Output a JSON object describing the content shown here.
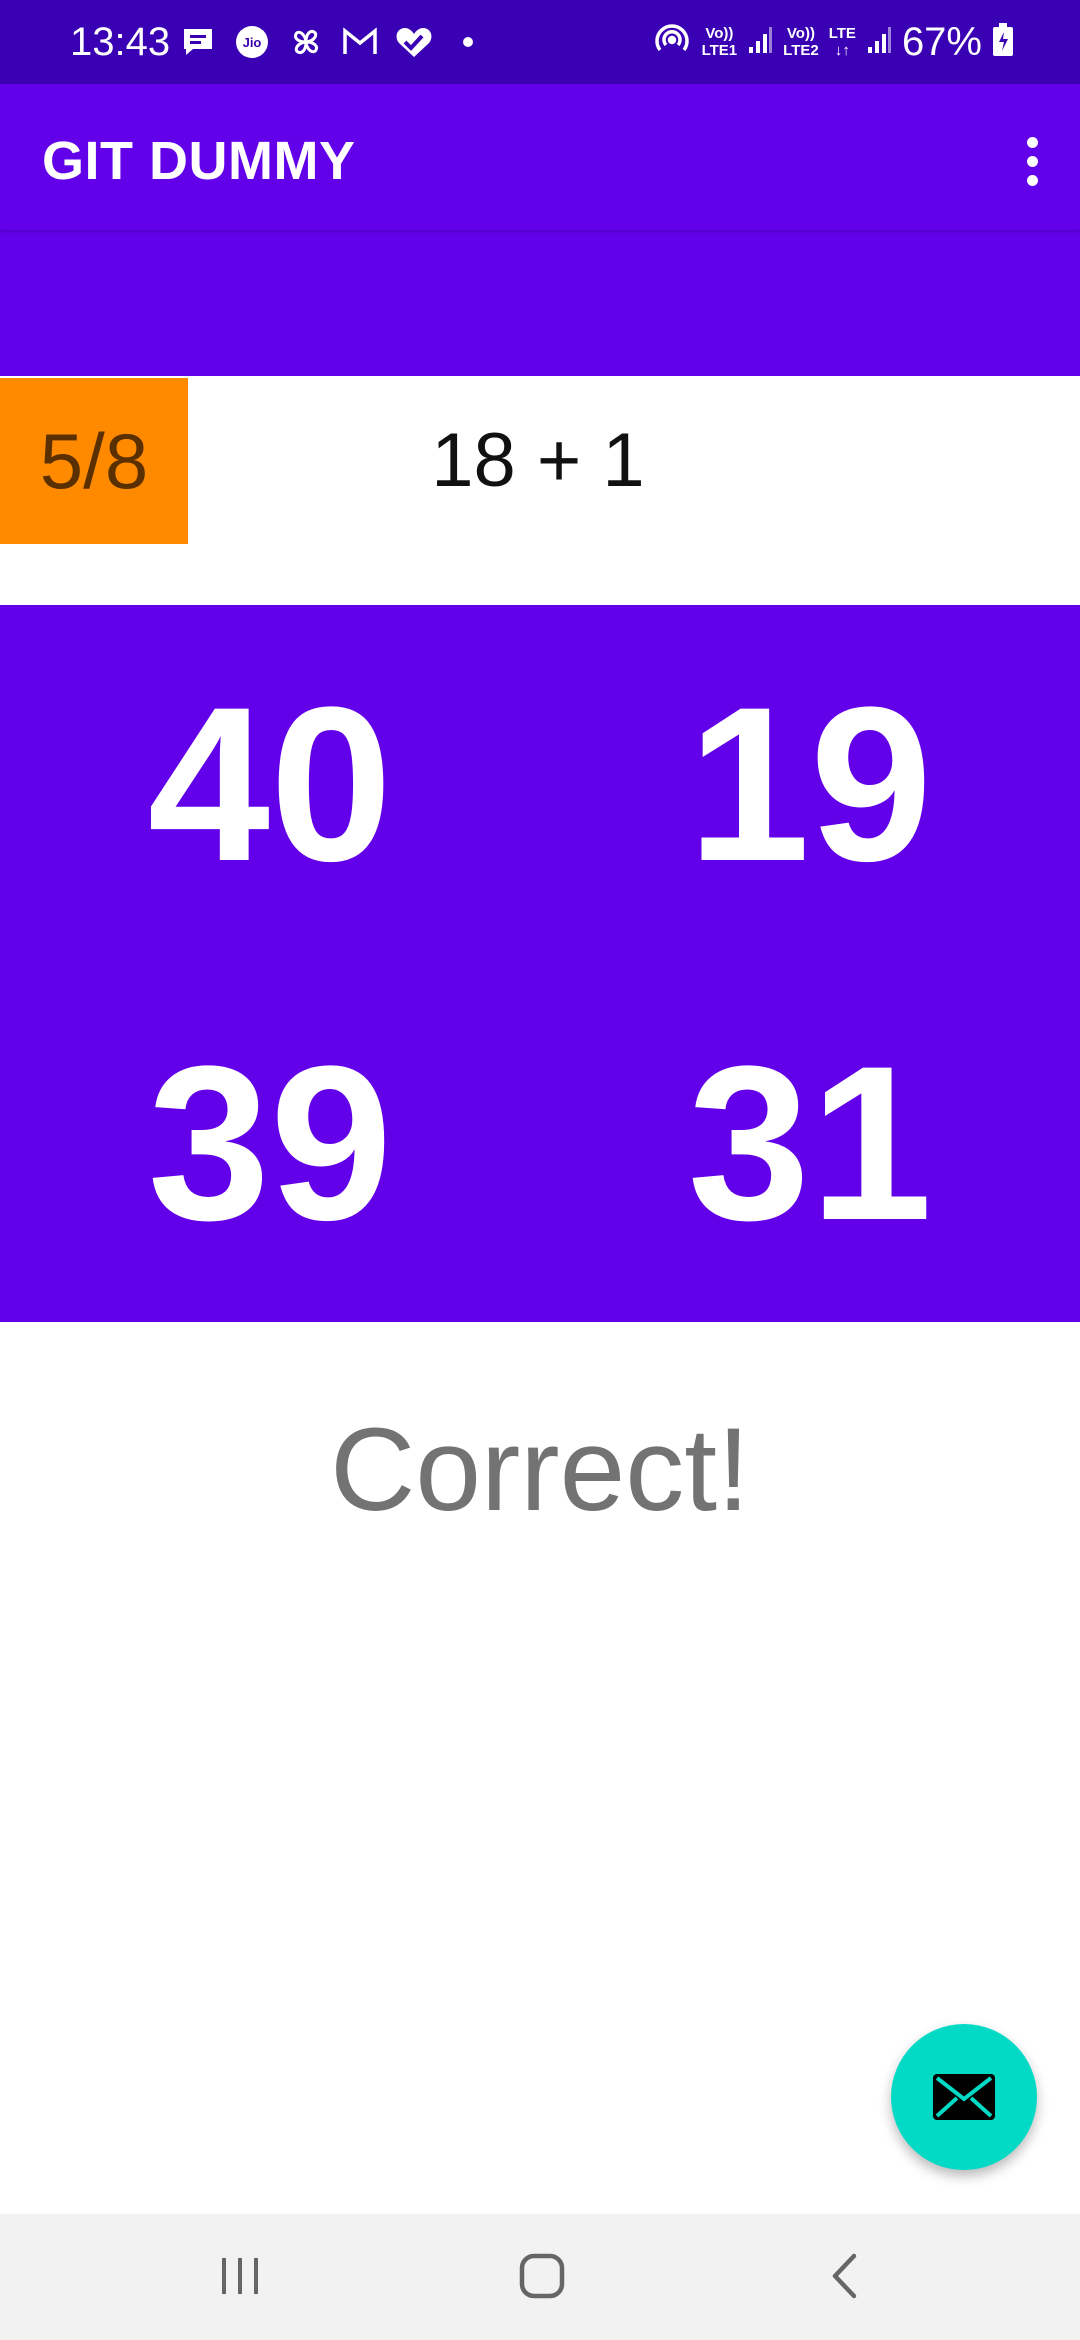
{
  "status_bar": {
    "time": "13:43",
    "net1_top": "Vo))",
    "net1_bottom": "LTE1",
    "net2_top": "Vo))",
    "net2_bottom": "LTE2",
    "net3_top": "LTE",
    "battery": "67%",
    "left_icons": [
      "message-icon",
      "jio-icon",
      "pinwheel-icon",
      "gmail-icon",
      "health-heart-icon",
      "dot-icon"
    ],
    "right_icons": [
      "hotspot-icon",
      "signal-icon",
      "battery-icon"
    ]
  },
  "app_bar": {
    "title": "GIT DUMMY",
    "overflow_icon": "more-vert-icon"
  },
  "game": {
    "score": "5/8",
    "question": "18 + 1",
    "answers": [
      "40",
      "19",
      "39",
      "31"
    ],
    "result": "Correct!"
  },
  "fab": {
    "icon": "mail-icon"
  },
  "nav": {
    "icons": [
      "recents-icon",
      "home-icon",
      "back-icon"
    ]
  },
  "colors": {
    "status_bar": "#3a00b3",
    "primary": "#6200ea",
    "score_badge": "#ff8a00",
    "fab": "#03dac5",
    "result_text": "#737373"
  }
}
